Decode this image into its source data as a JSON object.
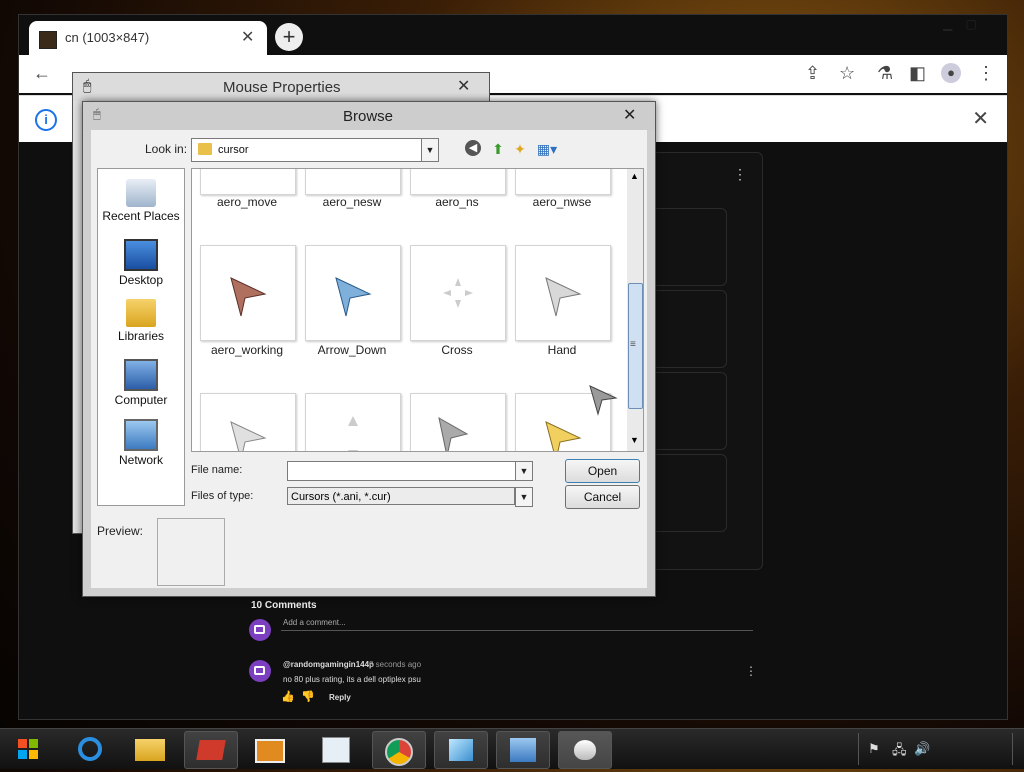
{
  "browser": {
    "tab_title": "cn (1003×847)",
    "tab_close": "✕",
    "new_tab": "+"
  },
  "comments": {
    "add_placeholder": "Add a comment...",
    "count_label": "10 Comments",
    "item": {
      "author": "@randomgamingin144p",
      "time": "8 seconds ago",
      "text": "no 80 plus rating, its a dell optiplex psu",
      "reply": "Reply"
    }
  },
  "mouse_properties": {
    "title": "Mouse Properties",
    "close": "✕"
  },
  "browse": {
    "title": "Browse",
    "close": "✕",
    "look_in_label": "Look in:",
    "look_in_value": "cursor",
    "places": [
      {
        "label": "Recent Places"
      },
      {
        "label": "Desktop"
      },
      {
        "label": "Libraries"
      },
      {
        "label": "Computer"
      },
      {
        "label": "Network"
      }
    ],
    "files_row1": [
      "aero_move",
      "aero_nesw",
      "aero_ns",
      "aero_nwse"
    ],
    "files_row2": [
      "aero_working",
      "Arrow_Down",
      "Cross",
      "Hand"
    ],
    "file_name_label": "File name:",
    "file_name_value": "",
    "files_of_type_label": "Files of type:",
    "files_of_type_value": "Cursors (*.ani, *.cur)",
    "open_button": "Open",
    "cancel_button": "Cancel",
    "preview_label": "Preview:"
  },
  "colors": {
    "link_blue": "#1a73e8",
    "avatar_purple": "#7b3fbf"
  }
}
